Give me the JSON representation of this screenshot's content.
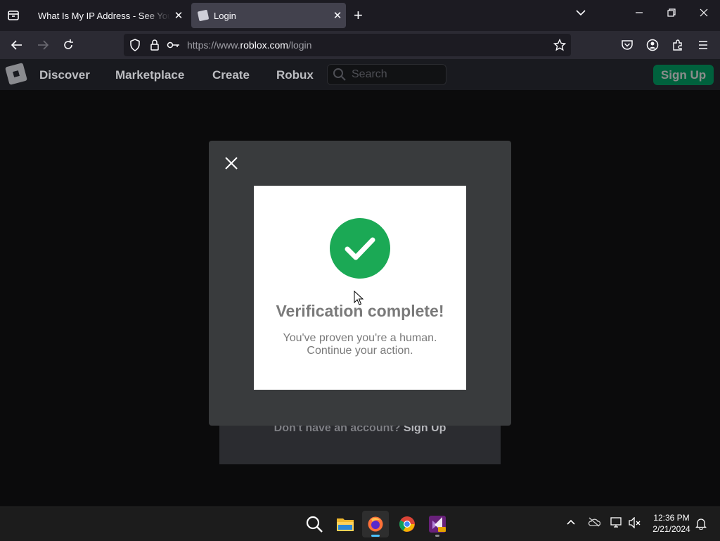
{
  "browser": {
    "tabs": [
      {
        "title": "What Is My IP Address - See Your Public IP",
        "close": "✕"
      },
      {
        "title": "Login",
        "close": "✕"
      }
    ],
    "new_tab": "+",
    "url_prefix": "https://www.",
    "url_domain": "roblox.com",
    "url_path": "/login"
  },
  "roblox_header": {
    "nav": [
      "Discover",
      "Marketplace",
      "Create",
      "Robux"
    ],
    "search_placeholder": "Search",
    "signup_label": "Sign Up",
    "signup_color": "#00b06f"
  },
  "background_page": {
    "prompt": "Don't have an account?",
    "link": "Sign Up"
  },
  "modal": {
    "title": "Verification complete!",
    "line1": "You've proven you're a human.",
    "line2": "Continue your action.",
    "success_color": "#1ba955"
  },
  "taskbar": {
    "apps": [
      "search-icon",
      "file-explorer-icon",
      "firefox-icon",
      "chrome-icon",
      "visual-studio-preview-icon"
    ],
    "time": "12:36 PM",
    "date": "2/21/2024"
  }
}
